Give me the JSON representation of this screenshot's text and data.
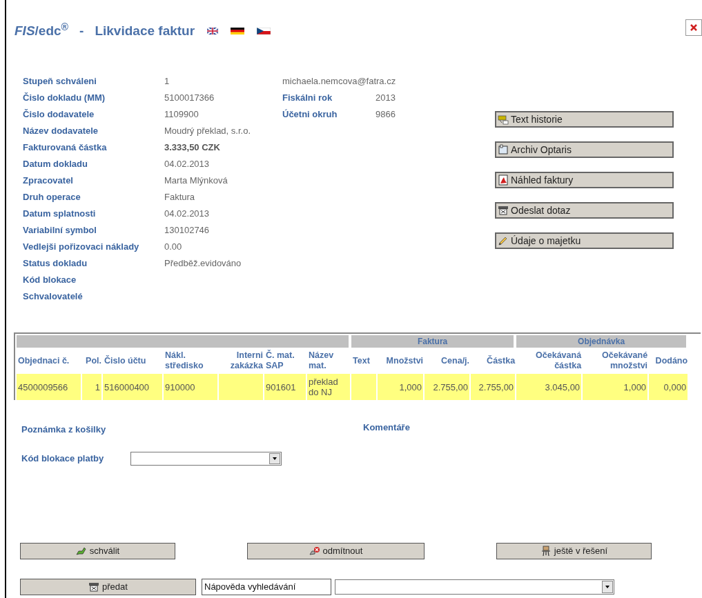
{
  "header": {
    "brand": "*FIS*/edc$^{®}$",
    "separator": "-",
    "title": "Likvidace faktur"
  },
  "details": [
    {
      "label": "Stupeň schváleni",
      "value": "1",
      "bold": false
    },
    {
      "label": "Čislo dokladu (MM)",
      "value": "5100017366",
      "bold": false
    },
    {
      "label": "Čislo dodavatele",
      "value": "1109900",
      "bold": false
    },
    {
      "label": "Název dodavatele",
      "value": "Moudrý překlad, s.r.o.",
      "bold": false
    },
    {
      "label": "Fakturovaná částka",
      "value": "3.333,50 CZK",
      "bold": true
    },
    {
      "label": "Datum dokladu",
      "value": "04.02.2013",
      "bold": false
    },
    {
      "label": "Zpracovatel",
      "value": "Marta Mlýnková",
      "bold": false
    },
    {
      "label": "Druh operace",
      "value": "Faktura",
      "bold": false
    },
    {
      "label": "Datum splatnosti",
      "value": "04.02.2013",
      "bold": false
    },
    {
      "label": "Variabilní symbol",
      "value": "130102746",
      "bold": false
    },
    {
      "label": "Vedlejši pořizovaci náklady",
      "value": "0.00",
      "bold": false
    },
    {
      "label": "Status dokladu",
      "value": "Předběž.evidováno",
      "bold": false
    },
    {
      "label": "Kód blokace"
    },
    {
      "label": "Schvalovatelé"
    }
  ],
  "email": "michaela.nemcova@fatra.cz",
  "fiscal": [
    {
      "label": "Fiskálni rok",
      "value": "2013"
    },
    {
      "label": "Účetni okruh",
      "value": "9866"
    }
  ],
  "side_buttons": [
    {
      "label": "Text historie",
      "kind": "history"
    },
    {
      "label": "Archiv Optaris",
      "kind": "archive"
    },
    {
      "label": "Náhled faktury",
      "kind": "pdf"
    },
    {
      "label": "Odeslat dotaz",
      "kind": "send"
    },
    {
      "label": "Údaje o majetku",
      "kind": "pencil"
    }
  ],
  "table": {
    "column_groups": [
      {
        "columns": [
          "Objednaci č.",
          "Pol.",
          "Čislo účtu",
          "Nákl. středisko",
          "Interni zakázka",
          "Č. mat. SAP",
          "Název mat."
        ]
      },
      {
        "label": "Faktura",
        "columns": [
          "Text",
          "Množstvi",
          "Cena/j.",
          "Částka"
        ]
      },
      {
        "label": "Objednávka",
        "columns": [
          "Očekávaná částka",
          "Očekávané množstvi",
          "Dodáno"
        ]
      }
    ],
    "rows": [
      {
        "cells": [
          "4500009566",
          "1",
          "516000400",
          "910000",
          null,
          "901601",
          "překlad do NJ",
          null,
          "1,000",
          "2.755,00",
          "2.755,00",
          "3.045,00",
          "1,000",
          "0,000"
        ]
      }
    ]
  },
  "note_label": "Poznámka z košilky",
  "comments_label": "Komentáře",
  "block_code": {
    "label": "Kód blokace platby"
  },
  "actions": [
    {
      "label": "schválit",
      "kind": "approve"
    },
    {
      "label": "odmítnout",
      "kind": "reject"
    },
    {
      "label": "ještě v řešení",
      "kind": "pending"
    }
  ],
  "forward": {
    "button": {
      "label": "předat",
      "kind": "send"
    },
    "search_help": "Nápověda vyhledávání"
  }
}
